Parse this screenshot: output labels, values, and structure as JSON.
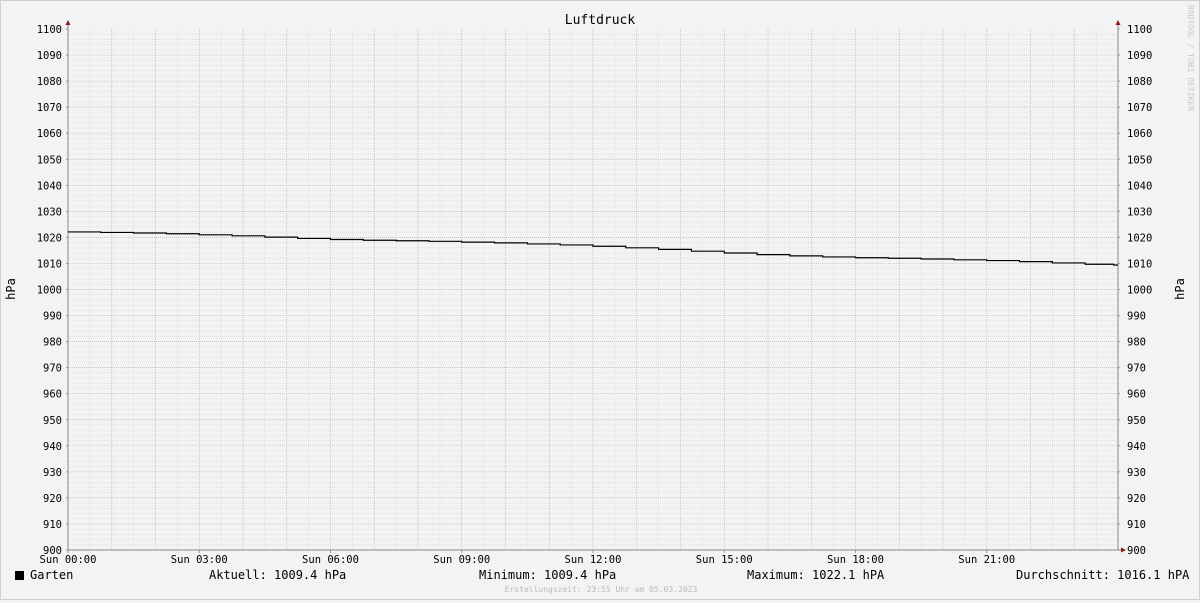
{
  "chart_data": {
    "type": "line",
    "title": "Luftdruck",
    "ylabel": "hPa",
    "ylabel_right": "hPa",
    "ylim": [
      900,
      1100
    ],
    "y_ticks": [
      900,
      910,
      920,
      930,
      940,
      950,
      960,
      970,
      980,
      990,
      1000,
      1010,
      1020,
      1030,
      1040,
      1050,
      1060,
      1070,
      1080,
      1090,
      1100
    ],
    "x_range_hours": [
      0,
      24
    ],
    "x_tick_hours": [
      0,
      3,
      6,
      9,
      12,
      15,
      18,
      21
    ],
    "x_tick_labels": [
      "Sun 00:00",
      "Sun 03:00",
      "Sun 06:00",
      "Sun 09:00",
      "Sun 12:00",
      "Sun 15:00",
      "Sun 18:00",
      "Sun 21:00"
    ],
    "grid": true,
    "series": [
      {
        "name": "Garten",
        "color": "#000000",
        "x_hours": [
          0,
          0.75,
          1.5,
          2.25,
          3,
          3.75,
          4.5,
          5.25,
          6,
          6.75,
          7.5,
          8.25,
          9,
          9.75,
          10.5,
          11.25,
          12,
          12.75,
          13.5,
          14.25,
          15,
          15.75,
          16.5,
          17.25,
          18,
          18.75,
          19.5,
          20.25,
          21,
          21.75,
          22.5,
          23.25,
          23.9
        ],
        "values": [
          1022.1,
          1021.9,
          1021.7,
          1021.4,
          1021.0,
          1020.6,
          1020.1,
          1019.6,
          1019.2,
          1018.9,
          1018.7,
          1018.5,
          1018.2,
          1017.9,
          1017.5,
          1017.1,
          1016.6,
          1016.0,
          1015.4,
          1014.7,
          1014.0,
          1013.4,
          1012.9,
          1012.5,
          1012.2,
          1012.0,
          1011.7,
          1011.4,
          1011.1,
          1010.7,
          1010.2,
          1009.7,
          1009.4
        ]
      }
    ]
  },
  "legend": {
    "series_name": "Garten",
    "aktuell": "Aktuell: 1009.4 hPa",
    "minimum": "Minimum: 1009.4 hPa",
    "maximum": "Maximum: 1022.1 hPA",
    "durchschnitt": "Durchschnitt: 1016.1 hPA"
  },
  "footer": "Erstellungszeit: 23:55 Uhr am 05.03.2023",
  "watermark": "RRDTOOL / TOBI OETIKER"
}
